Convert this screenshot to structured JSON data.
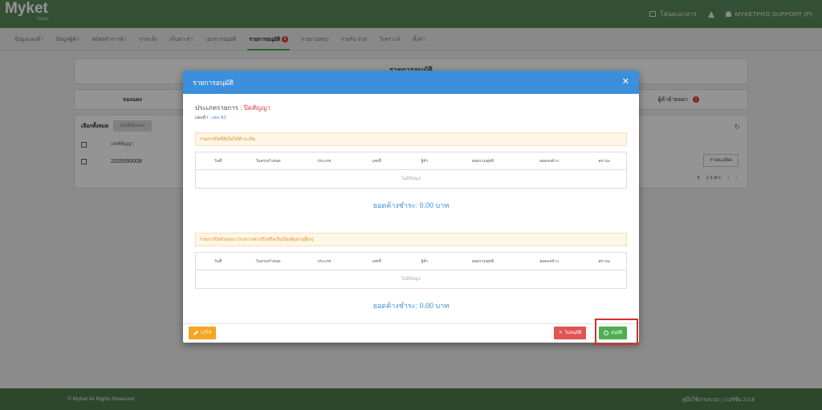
{
  "header": {
    "logo_text": "Myket",
    "logo_sub": "ระบบ",
    "doc_label": "โหนดเอกสาร",
    "user_label": "MYKETPRO SUPPORT (P)"
  },
  "nav": {
    "items": [
      "ข้อมูลแผงค้า",
      "ข้อมูลผู้ค้า",
      "สมัครทำการค้า",
      "การแจ้ง",
      "เก็บค่าเช่า",
      "เอกสารอนุมัติ",
      "รายการอนุมัติ",
      "รายงานสรุป",
      "รายรับ-จ่าย",
      "วิเคราะห์",
      "ตั้งค่า"
    ],
    "active_badge": "1"
  },
  "background": {
    "page_title": "รายการอนุมัติ",
    "tab_left": "จองแผง",
    "tab_right": "ผู้ค้าย้ายออก",
    "tab_right_badge": "1",
    "select_all": "เลือกทั้งหมด",
    "approve_all": "อนุมัติทั้งหมด",
    "col_contract": "เลขที่สัญญา",
    "row_contract": "2025090008",
    "detail_button": "รายละเอียด",
    "page_size": "5",
    "page_info": "1-1 of 1"
  },
  "modal": {
    "title": "รายการอนุมัติ",
    "type_label": "ประเภทรายการ : ",
    "type_value": "ปิดสัญญา",
    "stall_label": "แผงค้า : ",
    "stall_value": "แผง A3",
    "section1_alert": "รายการบิลที่ยังไม่ได้ชำระเงิน",
    "section2_alert": "รายการบิลย้ายออก (รายการค่าปรับหรือเก็บเงินเพิ่มส่วนอื่นๆ)",
    "columns": [
      "วันที่",
      "วันครบกำหนด",
      "ประเภท",
      "เลขที่",
      "ผู้ค้า",
      "ยอดรวมสุทธิ",
      "ยอดคงค้าง",
      "สถานะ"
    ],
    "no_data": "ไม่มีข้อมูล",
    "total1": "ยอดค้างชำระ: 0.00 บาท",
    "total2": "ยอดค้างชำระ: 0.00 บาท",
    "edit_button": "แก้ไข",
    "reject_button": "ไม่อนุมัติ",
    "approve_button": "อนุมัติ"
  },
  "footer": {
    "copyright": "© MyKet All Rights Reserved",
    "right_text": "คู่มือใช้งานระบบ | เวอร์ชั่น 2.0.6"
  },
  "colors": {
    "header_green": "#5a8a5a",
    "modal_blue": "#3b8fdc",
    "approve_green": "#4caf50",
    "reject_red": "#e05555",
    "edit_orange": "#f5a623",
    "highlight_red": "#d32f2f"
  }
}
